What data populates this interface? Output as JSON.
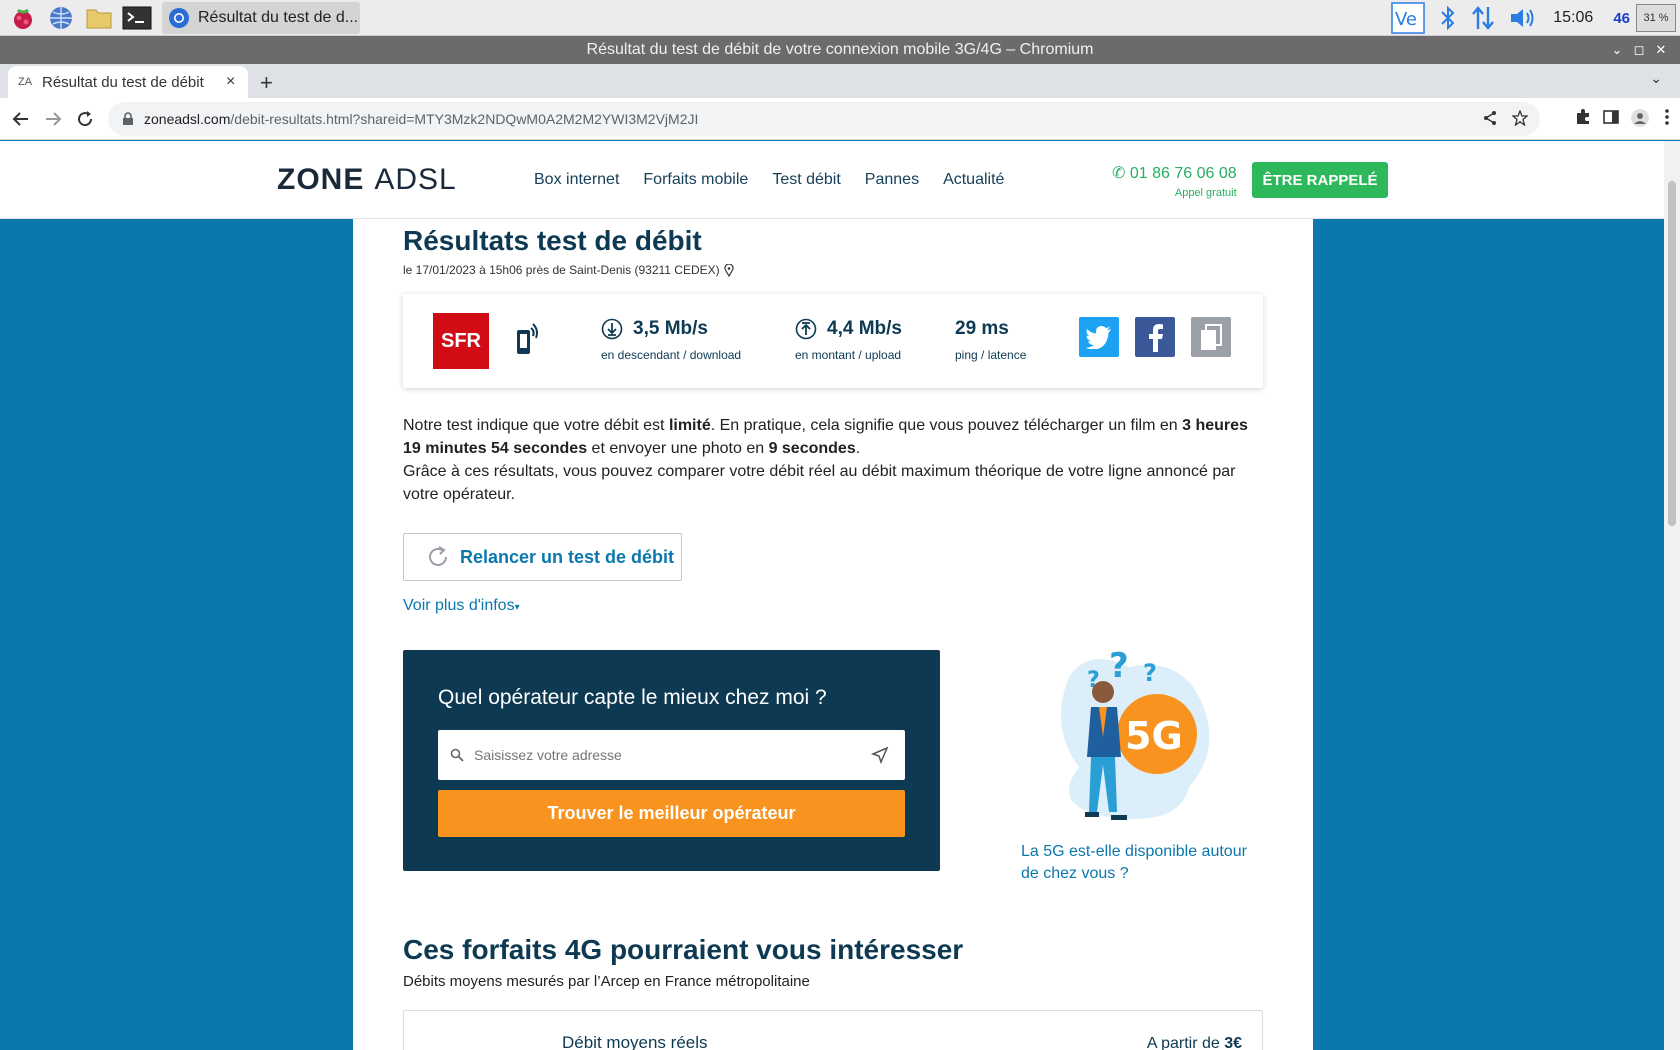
{
  "taskbar": {
    "task_label": "Résultat du test de d...",
    "clock": "15:06",
    "cpu_value": "46",
    "cpu_box": "31 %"
  },
  "window": {
    "title": "Résultat du test de débit de votre connexion mobile 3G/4G – Chromium"
  },
  "browser": {
    "tab_title": "Résultat du test de débit",
    "url_domain": "zoneadsl.com",
    "url_path": "/debit-resultats.html?shareid=MTY3Mzk2NDQwM0A2M2M2YWI3M2VjM2JI"
  },
  "site": {
    "logo_zone": "ZONE",
    "logo_adsl": "ADSL",
    "nav": [
      "Box internet",
      "Forfaits mobile",
      "Test débit",
      "Pannes",
      "Actualité"
    ],
    "phone": "01 86 76 06 08",
    "phone_sub": "Appel gratuit",
    "callback_label": "ÊTRE RAPPELÉ"
  },
  "results": {
    "title": "Résultats test de débit",
    "meta": "le 17/01/2023 à 15h06 près de Saint-Denis (93211 CEDEX)",
    "operator": "SFR",
    "download_value": "3,5 Mb/s",
    "download_label": "en descendant / download",
    "upload_value": "4,4 Mb/s",
    "upload_label": "en montant / upload",
    "ping_value": "29 ms",
    "ping_label": "ping / latence"
  },
  "summary": {
    "p1_a": "Notre test indique que votre débit est ",
    "p1_b": "limité",
    "p1_c": ". En pratique, cela signifie que vous pouvez télécharger un film en ",
    "p1_d": "3 heures 19 minutes 54 secondes",
    "p1_e": " et envoyer une photo en ",
    "p1_f": "9 secondes",
    "p1_g": ".",
    "p2": "Grâce à ces résultats, vous pouvez comparer votre débit réel au débit maximum théorique de votre ligne annoncé par votre opérateur."
  },
  "actions": {
    "retest_label": "Relancer un test de débit",
    "more_info": "Voir plus d'infos"
  },
  "operator_search": {
    "title": "Quel opérateur capte le mieux chez moi ?",
    "placeholder": "Saisissez votre adresse",
    "cta": "Trouver le meilleur opérateur"
  },
  "fiveg": {
    "illustration_text": "5G",
    "link": "La 5G est-elle disponible autour de chez vous ?"
  },
  "plans": {
    "title": "Ces forfaits 4G pourraient vous intéresser",
    "subtitle": "Débits moyens mesurés par l’Arcep en France métropolitaine",
    "col_left": "Débit moyens réels",
    "col_right_a": "A partir de ",
    "col_right_b": "3€"
  }
}
